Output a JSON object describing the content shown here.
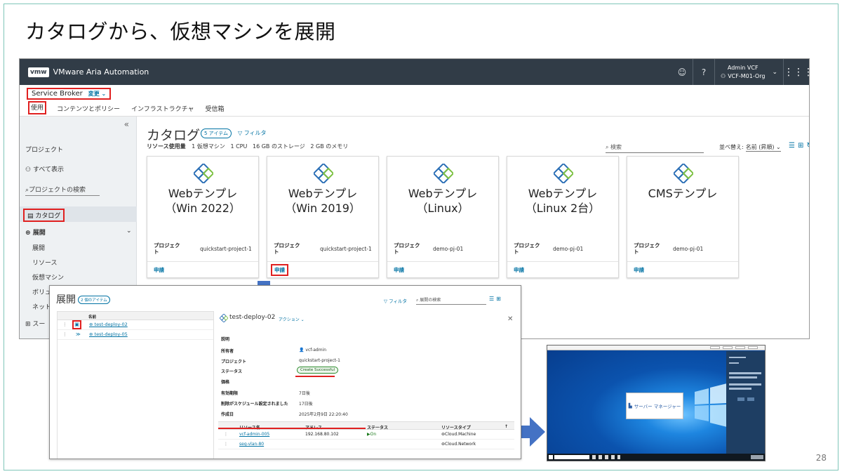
{
  "slide": {
    "title": "カタログから、仮想マシンを展開",
    "page_number": "28"
  },
  "app": {
    "logo": "vmw",
    "name": "VMware Aria Automation",
    "header_icons": [
      "smiley-icon",
      "help-icon"
    ],
    "user": {
      "name": "Admin VCF",
      "org": "VCF-M01-Org"
    },
    "service": {
      "name": "Service Broker",
      "change_label": "変更"
    },
    "nav_tabs": [
      "使用",
      "コンテンツとポリシー",
      "インフラストラクチャ",
      "受信箱"
    ],
    "sidebar": {
      "project_label": "プロジェクト",
      "show_all": "すべて表示",
      "project_search": "プロジェクトの検索",
      "catalog": "カタログ",
      "deploy_group": "展開",
      "sub_items": [
        "展開",
        "リソース",
        "仮想マシン",
        "ボリュ",
        "ネット"
      ],
      "last_item": "スー"
    },
    "catalog": {
      "title": "カタログ",
      "count_badge": "5 アイテム",
      "filter_label": "フィルタ",
      "usage_label": "リソース使用量",
      "usage_items": [
        "1 仮想マシン",
        "1 CPU",
        "16 GB のストレージ",
        "2 GB のメモリ"
      ],
      "search_placeholder": "検索",
      "sort_label": "並べ替え:",
      "sort_value": "名前 (昇順)",
      "cards": [
        {
          "name": "Webテンプレ\n（Win 2022）",
          "project_label": "プロジェク\nト",
          "project": "quickstart-project-1",
          "request": "申請"
        },
        {
          "name": "Webテンプレ\n（Win 2019）",
          "project_label": "プロジェク\nト",
          "project": "quickstart-project-1",
          "request": "申請"
        },
        {
          "name": "Webテンプレ\n（Linux）",
          "project_label": "プロジェク\nト",
          "project": "demo-pj-01",
          "request": "申請"
        },
        {
          "name": "Webテンプレ\n（Linux 2台）",
          "project_label": "プロジェク\nト",
          "project": "demo-pj-01",
          "request": "申請"
        },
        {
          "name": "CMSテンプレ",
          "project_label": "プロジェク\nト",
          "project": "demo-pj-01",
          "request": "申請"
        }
      ]
    }
  },
  "deployments": {
    "title": "展開",
    "count_badge": "2 個のアイテム",
    "filter_label": "フィルタ",
    "search_placeholder": "展開の検索",
    "column_name": "名前",
    "rows": [
      "test-deploy-02",
      "test-deploy-05"
    ],
    "detail": {
      "name": "test-deploy-02",
      "actions_label": "アクション",
      "description_label": "説明",
      "fields": [
        {
          "label": "所有者",
          "value": "vcf-admin"
        },
        {
          "label": "プロジェクト",
          "value": "quickstart-project-1"
        },
        {
          "label": "ステータス",
          "value": "Create Successful"
        },
        {
          "label": "価格",
          "value": ""
        },
        {
          "label": "有効期限",
          "value": "7日後"
        },
        {
          "label": "削除がスケジュール設定されました",
          "value": "17日後"
        },
        {
          "label": "作成日",
          "value": "2025年2月9日 22:20:40"
        }
      ],
      "resource_columns": [
        "リソース名",
        "アドレス",
        "ステータス",
        "リソースタイプ"
      ],
      "resources": [
        {
          "name": "vcf-admin-005",
          "address": "192.168.80.102",
          "status": "On",
          "type": "Cloud.Machine"
        },
        {
          "name": "seg-vlan-80",
          "address": "",
          "status": "",
          "type": "Cloud.Network"
        }
      ]
    }
  },
  "desktop": {
    "server_manager": "サーバー マネージャー"
  },
  "colors": {
    "header": "#313c47",
    "link": "#0072a3",
    "highlight": "#e02020",
    "accent_arrow": "#4472c4"
  }
}
